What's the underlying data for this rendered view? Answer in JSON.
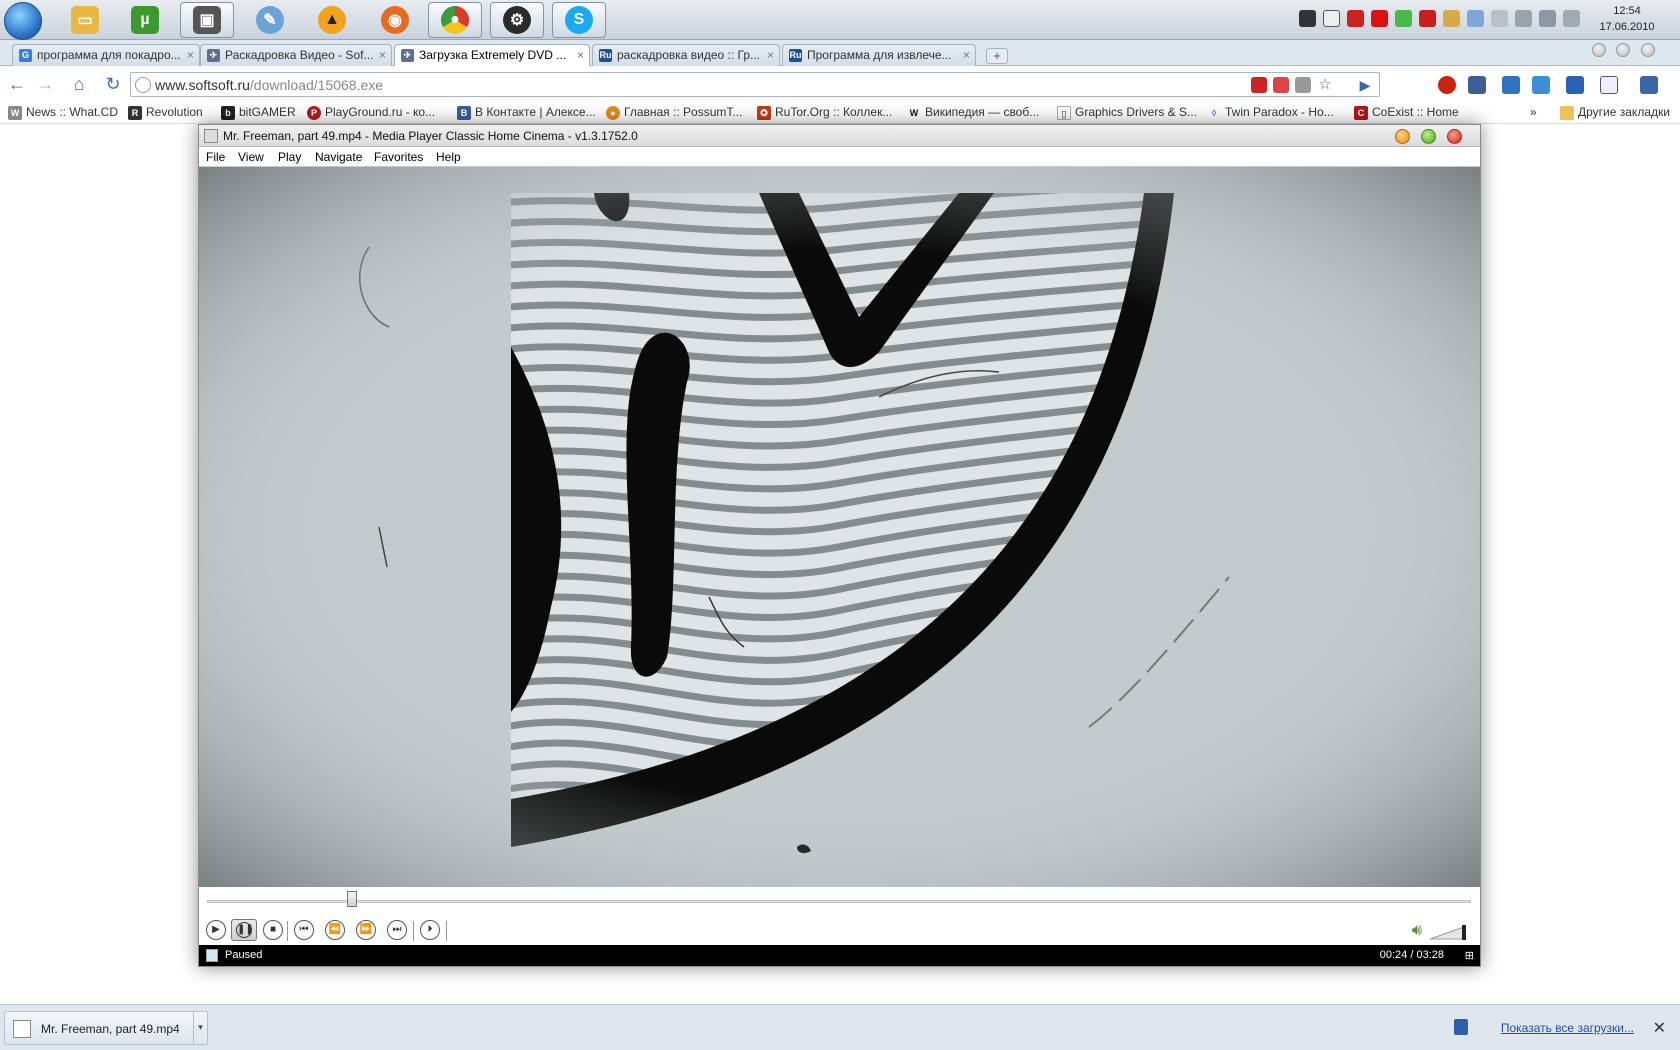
{
  "taskbar": {
    "clock_time": "12:54",
    "clock_date": "17.06.2010",
    "apps": [
      {
        "name": "explorer-icon",
        "color": "#e8b844"
      },
      {
        "name": "utorrent-icon",
        "color": "#3a9a2e"
      },
      {
        "name": "video-editor-icon",
        "color": "#555555"
      },
      {
        "name": "paint-icon",
        "color": "#6ba3d6"
      },
      {
        "name": "aimp-icon",
        "color": "#f2a21b"
      },
      {
        "name": "firefox-icon",
        "color": "#e66a1f"
      },
      {
        "name": "chrome-icon",
        "color": "#3d9a3d"
      },
      {
        "name": "steam-icon",
        "color": "#2b2b2b"
      },
      {
        "name": "skype-icon",
        "color": "#1ba9ef"
      }
    ]
  },
  "browser": {
    "tabs": [
      {
        "label": "программа для покадро...",
        "favicon_color": "#3b7ddd",
        "favicon_text": "G"
      },
      {
        "label": "Раскадровка Видео - Sof...",
        "favicon_color": "#5d6e8f",
        "favicon_text": "✈"
      },
      {
        "label": "Загрузка Extremely DVD ...",
        "favicon_color": "#5d6e8f",
        "favicon_text": "✈"
      },
      {
        "label": "раскадровка видео :: Гр...",
        "favicon_color": "#1f4e9a",
        "favicon_text": "Ru"
      },
      {
        "label": "Программа для извлече...",
        "favicon_color": "#1f4e9a",
        "favicon_text": "Ru"
      }
    ],
    "active_tab": 2,
    "url_host": "www.softsoft.ru",
    "url_path": "/download/15068.exe",
    "bookmarks": [
      {
        "label": "News :: What.CD",
        "color": "#888888",
        "icon": "W"
      },
      {
        "label": "Revolution",
        "color": "#333333",
        "icon": "R"
      },
      {
        "label": "bitGAMER",
        "color": "#222222",
        "icon": "b"
      },
      {
        "label": "PlayGround.ru - ко...",
        "color": "#b21c1c",
        "icon": "P"
      },
      {
        "label": "В Контакте | Алексе...",
        "color": "#3b5f9a",
        "icon": "B"
      },
      {
        "label": "Главная :: PossumT...",
        "color": "#e48a1e",
        "icon": "●"
      },
      {
        "label": "RuTor.Org :: Коллек...",
        "color": "#c33a1a",
        "icon": "✪"
      },
      {
        "label": "Википедия — своб...",
        "color": "#ffffff",
        "icon": "W"
      },
      {
        "label": "Graphics Drivers & S...",
        "color": "#ffffff",
        "icon": "▯"
      },
      {
        "label": "Twin Paradox - Ho...",
        "color": "#4a6fd6",
        "icon": "◊"
      },
      {
        "label": "CoExist :: Home",
        "color": "#b01818",
        "icon": "C"
      }
    ],
    "more_bookmarks_label": "»",
    "other_bookmarks_label": "Другие закладки"
  },
  "player": {
    "title": "Mr. Freeman, part 49.mp4 - Media Player Classic Home Cinema - v1.3.1752.0",
    "menu": [
      "File",
      "View",
      "Play",
      "Navigate",
      "Favorites",
      "Help"
    ],
    "status": "Paused",
    "time": "00:24 / 03:28",
    "progress_fraction": 0.115,
    "volume_fraction": 1.0
  },
  "downloads": {
    "item_name": "Mr. Freeman, part 49.mp4",
    "show_all_label": "Показать все загрузки..."
  }
}
